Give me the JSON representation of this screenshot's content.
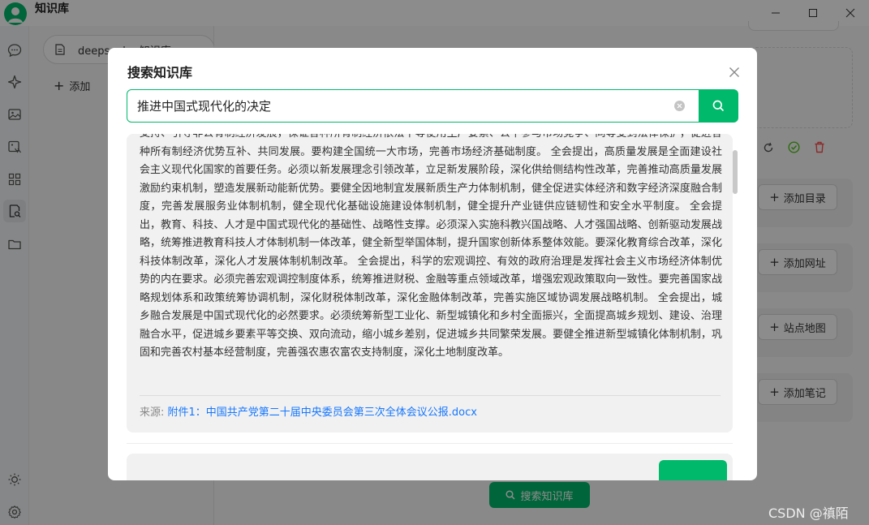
{
  "app": {
    "title": "知识库",
    "window_controls": [
      "minimize",
      "maximize",
      "close"
    ]
  },
  "rail": {
    "icons": [
      "chat-icon",
      "sparkle-icon",
      "image-icon",
      "translate-image-icon",
      "apps-grid-icon",
      "knowledge-search-icon",
      "folder-icon"
    ],
    "bottom_icons": [
      "theme-sun-icon",
      "settings-gear-icon"
    ],
    "active": "knowledge-search-icon"
  },
  "knowledge_list": {
    "items": [
      {
        "label": "deepseek - 知识库"
      }
    ],
    "add_label": "添加"
  },
  "right_panel": {
    "buttons": [
      "添加目录",
      "添加网址",
      "站点地图",
      "添加笔记"
    ],
    "search_label": "搜索知识库"
  },
  "modal": {
    "title": "搜索知识库",
    "search": {
      "value": "推进中国式现代化的决定",
      "placeholder": ""
    },
    "result": {
      "text": "支持、引导非公有制经济发展，保证各种所有制经济依法平等使用生产要素、公平参与市场竞争、同等受到法律保护，促进各种所有制经济优势互补、共同发展。要构建全国统一大市场，完善市场经济基础制度。 全会提出，高质量发展是全面建设社会主义现代化国家的首要任务。必须以新发展理念引领改革，立足新发展阶段，深化供给侧结构性改革，完善推动高质量发展激励约束机制，塑造发展新动能新优势。要健全因地制宜发展新质生产力体制机制，健全促进实体经济和数字经济深度融合制度，完善发展服务业体制机制，健全现代化基础设施建设体制机制，健全提升产业链供应链韧性和安全水平制度。 全会提出，教育、科技、人才是中国式现代化的基础性、战略性支撑。必须深入实施科教兴国战略、人才强国战略、创新驱动发展战略，统筹推进教育科技人才体制机制一体改革，健全新型举国体制，提升国家创新体系整体效能。要深化教育综合改革，深化科技体制改革，深化人才发展体制机制改革。 全会提出，科学的宏观调控、有效的政府治理是发挥社会主义市场经济体制优势的内在要求。必须完善宏观调控制度体系，统筹推进财税、金融等重点领域改革，增强宏观政策取向一致性。要完善国家战略规划体系和政策统筹协调机制，深化财税体制改革，深化金融体制改革，完善实施区域协调发展战略机制。 全会提出，城乡融合发展是中国式现代化的必然要求。必须统筹新型工业化、新型城镇化和乡村全面振兴，全面提高城乡规划、建设、治理融合水平，促进城乡要素平等交换、双向流动，缩小城乡差别，促进城乡共同繁荣发展。要健全推进新型城镇化体制机制，巩固和完善农村基本经营制度，完善强农惠农富农支持制度，深化土地制度改革。",
      "source_label": "来源: ",
      "source_link": "附件1：中国共产党第二十届中央委员会第三次全体会议公报.docx"
    }
  },
  "watermark": "CSDN @禛陌",
  "colors": {
    "accent": "#00b96b",
    "link": "#1677ff",
    "danger": "#ff4d4f"
  }
}
